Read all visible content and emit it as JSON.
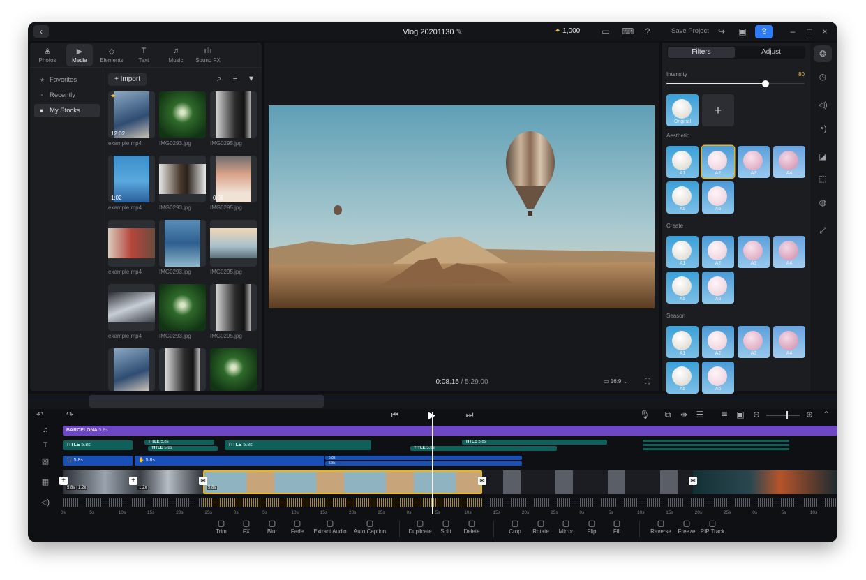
{
  "titlebar": {
    "project": "Vlog 20201130",
    "credits": "1,000",
    "save_label": "Save Project"
  },
  "tabs": [
    {
      "label": "Photos",
      "icon": "photos-icon"
    },
    {
      "label": "Media",
      "icon": "media-icon"
    },
    {
      "label": "Elements",
      "icon": "elements-icon"
    },
    {
      "label": "Text",
      "icon": "text-icon"
    },
    {
      "label": "Music",
      "icon": "music-icon"
    },
    {
      "label": "Sound FX",
      "icon": "sound-fx-icon"
    }
  ],
  "sidebar": {
    "items": [
      {
        "label": "Favorites"
      },
      {
        "label": "Recently"
      },
      {
        "label": "My Stocks"
      }
    ]
  },
  "media": {
    "import_label": "Import",
    "items": [
      {
        "name": "example.mp4",
        "duration": "12:02",
        "starred": true
      },
      {
        "name": "IMG0293.jpg"
      },
      {
        "name": "IMG0295.jpg"
      },
      {
        "name": "example.mp4",
        "duration": "1:02"
      },
      {
        "name": "IMG0293.jpg"
      },
      {
        "name": "IMG0295.jpg",
        "duration": "0:06"
      },
      {
        "name": "example.mp4"
      },
      {
        "name": "IMG0293.jpg"
      },
      {
        "name": "IMG0295.jpg"
      },
      {
        "name": "example.mp4"
      },
      {
        "name": "IMG0293.jpg"
      },
      {
        "name": "IMG0295.jpg"
      }
    ]
  },
  "preview": {
    "time_current": "0:08.15",
    "time_sep": "/",
    "time_total": "5:29.00",
    "aspect": "16:9"
  },
  "filters": {
    "tab_filters": "Filters",
    "tab_adjust": "Adjust",
    "intensity_label": "Intensity",
    "intensity_value": "80",
    "original_label": "Original",
    "sections": [
      {
        "title": "Aesthetic",
        "items": [
          "A1",
          "A2",
          "A3",
          "A4",
          "A5",
          "A6"
        ]
      },
      {
        "title": "Create",
        "items": [
          "A1",
          "A2",
          "A3",
          "A4",
          "A5",
          "A6"
        ]
      },
      {
        "title": "Season",
        "items": [
          "A1",
          "A2",
          "A3",
          "A4",
          "A5",
          "A6"
        ]
      }
    ]
  },
  "timeline": {
    "music_clip": "BARCELONA",
    "music_clip_dur": "5.8s",
    "title_clips": [
      "TITLE",
      "TITLE",
      "TITLE",
      "TITLE",
      "TITLE",
      "TITLE"
    ],
    "title_dur": "5.8s",
    "sticker_dur": "5.8s",
    "sticker_small": [
      "5.8s",
      "5.8s"
    ],
    "video_badges": [
      "5.8s",
      "1.2x",
      "1.2x",
      "5.8s"
    ],
    "ruler": [
      "0s",
      "5s",
      "10s",
      "15s",
      "20s",
      "25s",
      "0s",
      "5s",
      "10s",
      "15s",
      "20s",
      "25s",
      "0s",
      "5s",
      "10s",
      "15s",
      "20s",
      "25s",
      "0s",
      "5s",
      "10s",
      "15s",
      "20s",
      "25s",
      "0s",
      "5s",
      "10s",
      "15s"
    ]
  },
  "toolbar": [
    {
      "label": "Trim",
      "icon": "trim-icon"
    },
    {
      "label": "FX",
      "icon": "fx-icon"
    },
    {
      "label": "Blur",
      "icon": "blur-icon"
    },
    {
      "label": "Fade",
      "icon": "fade-icon"
    },
    {
      "label": "Extract Audio",
      "icon": "extract-audio-icon"
    },
    {
      "label": "Auto Caption",
      "icon": "auto-caption-icon"
    },
    {
      "label": "Duplicate",
      "icon": "duplicate-icon"
    },
    {
      "label": "Split",
      "icon": "split-icon"
    },
    {
      "label": "Delete",
      "icon": "delete-icon"
    },
    {
      "label": "Crop",
      "icon": "crop-icon"
    },
    {
      "label": "Rotate",
      "icon": "rotate-icon"
    },
    {
      "label": "Mirror",
      "icon": "mirror-icon"
    },
    {
      "label": "Flip",
      "icon": "flip-icon"
    },
    {
      "label": "Fill",
      "icon": "fill-icon"
    },
    {
      "label": "Reverse",
      "icon": "reverse-icon"
    },
    {
      "label": "Freeze",
      "icon": "freeze-icon"
    },
    {
      "label": "PIP Track",
      "icon": "pip-track-icon"
    }
  ],
  "colors": {
    "accent": "#2f7cf6",
    "selection": "#e6b81f",
    "music": "#6d47c4",
    "title_track": "#0f5f5a",
    "sticker_track": "#1750b8"
  }
}
